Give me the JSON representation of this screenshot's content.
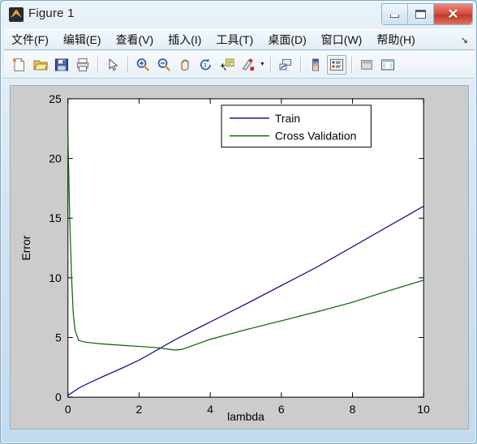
{
  "window": {
    "title": "Figure 1",
    "app_icon": "matlab-figure-icon",
    "controls": {
      "minimize_label": "Minimize",
      "maximize_label": "Maximize",
      "close_label": "Close"
    }
  },
  "menubar": {
    "items": [
      {
        "label": "文件(F)",
        "name": "menu-file"
      },
      {
        "label": "编辑(E)",
        "name": "menu-edit"
      },
      {
        "label": "查看(V)",
        "name": "menu-view"
      },
      {
        "label": "插入(I)",
        "name": "menu-insert"
      },
      {
        "label": "工具(T)",
        "name": "menu-tools"
      },
      {
        "label": "桌面(D)",
        "name": "menu-desktop"
      },
      {
        "label": "窗口(W)",
        "name": "menu-window"
      },
      {
        "label": "帮助(H)",
        "name": "menu-help"
      }
    ],
    "overflow_glyph": "↘"
  },
  "toolbar": {
    "buttons": [
      {
        "name": "new-figure-icon",
        "tooltip": "New Figure"
      },
      {
        "name": "open-file-icon",
        "tooltip": "Open File"
      },
      {
        "name": "save-figure-icon",
        "tooltip": "Save Figure"
      },
      {
        "name": "print-figure-icon",
        "tooltip": "Print Figure"
      },
      {
        "name": "edit-plot-arrow-icon",
        "tooltip": "Edit Plot"
      },
      {
        "name": "zoom-in-icon",
        "tooltip": "Zoom In"
      },
      {
        "name": "zoom-out-icon",
        "tooltip": "Zoom Out"
      },
      {
        "name": "pan-hand-icon",
        "tooltip": "Pan"
      },
      {
        "name": "rotate-3d-icon",
        "tooltip": "Rotate 3D"
      },
      {
        "name": "data-cursor-icon",
        "tooltip": "Data Cursor"
      },
      {
        "name": "brush-icon",
        "tooltip": "Brush/Select Data"
      },
      {
        "name": "link-plot-icon",
        "tooltip": "Link Plot"
      },
      {
        "name": "colorbar-icon",
        "tooltip": "Insert Colorbar"
      },
      {
        "name": "legend-icon",
        "tooltip": "Insert Legend"
      },
      {
        "name": "plot-browser-icon",
        "tooltip": "Hide Plot Tools"
      },
      {
        "name": "show-plot-tools-icon",
        "tooltip": "Show Plot Tools and Dock Figure"
      }
    ]
  },
  "chart_data": {
    "type": "line",
    "title": "",
    "xlabel": "lambda",
    "ylabel": "Error",
    "xlim": [
      0,
      10
    ],
    "ylim": [
      0,
      25
    ],
    "xticks": [
      0,
      2,
      4,
      6,
      8,
      10
    ],
    "yticks": [
      0,
      5,
      10,
      15,
      20,
      25
    ],
    "grid": false,
    "legend_position": "top-right",
    "background": "#ffffff",
    "figure_background": "#cccccc",
    "series": [
      {
        "name": "Train",
        "color": "#000080",
        "x": [
          0,
          0.3,
          0.6,
          1,
          1.5,
          2,
          2.3,
          3,
          4,
          5,
          6,
          7,
          8,
          9,
          10
        ],
        "y": [
          0.15,
          0.75,
          1.2,
          1.75,
          2.4,
          3.1,
          3.6,
          4.8,
          6.3,
          7.8,
          9.35,
          10.9,
          12.6,
          14.3,
          16.0
        ]
      },
      {
        "name": "Cross Validation",
        "color": "#006400",
        "x": [
          0,
          0.05,
          0.1,
          0.15,
          0.2,
          0.3,
          0.5,
          1,
          1.5,
          2,
          2.5,
          3,
          3.2,
          4,
          5,
          6,
          7,
          8,
          9,
          10
        ],
        "y": [
          22.0,
          15.0,
          10.2,
          7.0,
          5.6,
          4.75,
          4.6,
          4.45,
          4.35,
          4.25,
          4.15,
          3.95,
          4.0,
          4.85,
          5.65,
          6.4,
          7.15,
          7.95,
          8.9,
          9.8
        ]
      }
    ]
  },
  "legend": {
    "entries": [
      {
        "label": "Train",
        "color": "#000080"
      },
      {
        "label": "Cross Validation",
        "color": "#006400"
      }
    ]
  }
}
